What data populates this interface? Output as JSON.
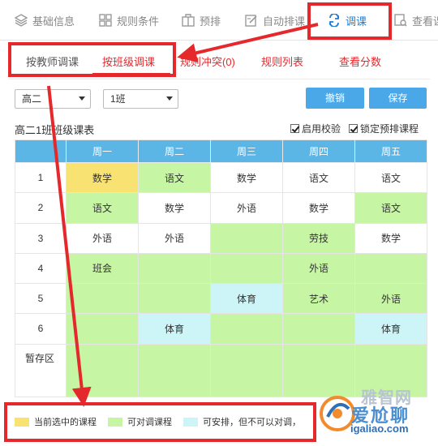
{
  "nav": {
    "items": [
      {
        "label": "基础信息",
        "icon": "layers-icon"
      },
      {
        "label": "规则条件",
        "icon": "grid-icon"
      },
      {
        "label": "预排",
        "icon": "puzzle-icon"
      },
      {
        "label": "自动排课",
        "icon": "edit-icon"
      },
      {
        "label": "调课",
        "icon": "swap-icon",
        "active": true
      },
      {
        "label": "查看课",
        "icon": "view-icon"
      }
    ]
  },
  "subtabs": {
    "teacher": "按教师调课",
    "class": "按班级调课",
    "conflict": "规则冲突(0)",
    "rules": "规则列表",
    "scores": "查看分数"
  },
  "controls": {
    "grade": "高二",
    "class": "1班",
    "undo": "撤销",
    "save": "保存"
  },
  "table": {
    "title": "高二1班班级课表",
    "check_validate": "启用校验",
    "check_lock": "锁定预排课程",
    "days": [
      "周一",
      "周二",
      "周三",
      "周四",
      "周五"
    ],
    "rows": [
      {
        "label": "1",
        "cells": [
          {
            "t": "数学",
            "c": "y"
          },
          {
            "t": "语文",
            "c": "g"
          },
          {
            "t": "数学",
            "c": "w"
          },
          {
            "t": "语文",
            "c": "w"
          },
          {
            "t": "语文",
            "c": "w"
          }
        ]
      },
      {
        "label": "2",
        "cells": [
          {
            "t": "语文",
            "c": "g"
          },
          {
            "t": "数学",
            "c": "w"
          },
          {
            "t": "外语",
            "c": "w"
          },
          {
            "t": "数学",
            "c": "w"
          },
          {
            "t": "语文",
            "c": "g"
          }
        ]
      },
      {
        "label": "3",
        "cells": [
          {
            "t": "外语",
            "c": "w"
          },
          {
            "t": "外语",
            "c": "w"
          },
          {
            "t": "",
            "c": "g"
          },
          {
            "t": "劳技",
            "c": "g"
          },
          {
            "t": "数学",
            "c": "w"
          }
        ]
      },
      {
        "label": "4",
        "cells": [
          {
            "t": "班会",
            "c": "g"
          },
          {
            "t": "",
            "c": "g"
          },
          {
            "t": "",
            "c": "g"
          },
          {
            "t": "外语",
            "c": "g"
          },
          {
            "t": "",
            "c": "g"
          }
        ]
      },
      {
        "label": "5",
        "cells": [
          {
            "t": "",
            "c": "g"
          },
          {
            "t": "",
            "c": "g"
          },
          {
            "t": "体育",
            "c": "b"
          },
          {
            "t": "艺术",
            "c": "g"
          },
          {
            "t": "外语",
            "c": "g"
          }
        ]
      },
      {
        "label": "6",
        "cells": [
          {
            "t": "",
            "c": "g"
          },
          {
            "t": "体育",
            "c": "b"
          },
          {
            "t": "",
            "c": "g"
          },
          {
            "t": "",
            "c": "g"
          },
          {
            "t": "体育",
            "c": "b"
          }
        ]
      }
    ],
    "stash_label": "暂存区"
  },
  "legend": {
    "selected": "当前选中的课程",
    "swappable": "可对调课程",
    "placeable": "可安排，但不可以对调，"
  },
  "colors": {
    "selected": "#f8e372",
    "swappable": "#c6f5a4",
    "placeable": "#cdf5f7",
    "header": "#5bb5e5",
    "accent": "#e5282c",
    "primary": "#4aa8e8"
  },
  "watermark": {
    "line1": "雅智网",
    "line2": "爱尬聊",
    "line3": "igaliao.com"
  }
}
